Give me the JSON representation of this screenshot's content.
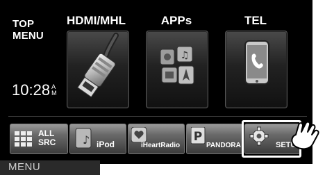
{
  "top_menu": {
    "line1": "TOP",
    "line2": "MENU"
  },
  "columns": [
    {
      "title": "HDMI/MHL",
      "icon": "hdmi-cable-icon"
    },
    {
      "title": "APPs",
      "icon": "apps-grid-icon"
    },
    {
      "title": "TEL",
      "icon": "phone-icon"
    }
  ],
  "clock": {
    "time": "10:28",
    "ampm_top": "A",
    "ampm_bottom": "M"
  },
  "sources": [
    {
      "label_line1": "ALL",
      "label_line2": "SRC",
      "icon": "all-sources-grid-icon"
    },
    {
      "label": "iPod",
      "icon": "ipod-icon"
    },
    {
      "label": "iHeartRadio",
      "icon": "iheartradio-icon"
    },
    {
      "label": "PANDORA",
      "icon": "pandora-icon"
    },
    {
      "label": "SETUP",
      "icon": "gear-icon"
    }
  ],
  "menu": {
    "label": "MENU"
  },
  "colors": {
    "background": "#000000",
    "highlight": "#ffffff",
    "button": "#6a6a6a"
  }
}
